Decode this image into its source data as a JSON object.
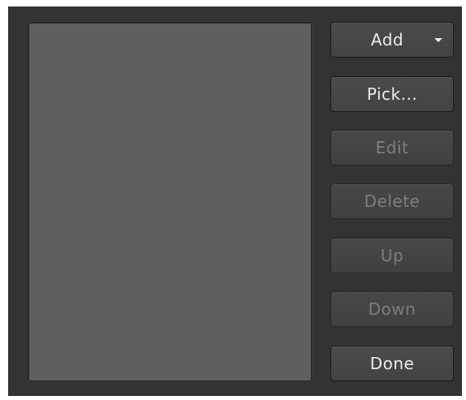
{
  "buttons": {
    "add_label": "Add",
    "pick_label": "Pick...",
    "edit_label": "Edit",
    "delete_label": "Delete",
    "up_label": "Up",
    "down_label": "Down",
    "done_label": "Done"
  },
  "icons": {
    "add_dropdown": "chevron-down-icon"
  },
  "state": {
    "add_enabled": true,
    "pick_enabled": true,
    "edit_enabled": false,
    "delete_enabled": false,
    "up_enabled": false,
    "down_enabled": false,
    "done_enabled": true
  },
  "list": {
    "items": []
  }
}
